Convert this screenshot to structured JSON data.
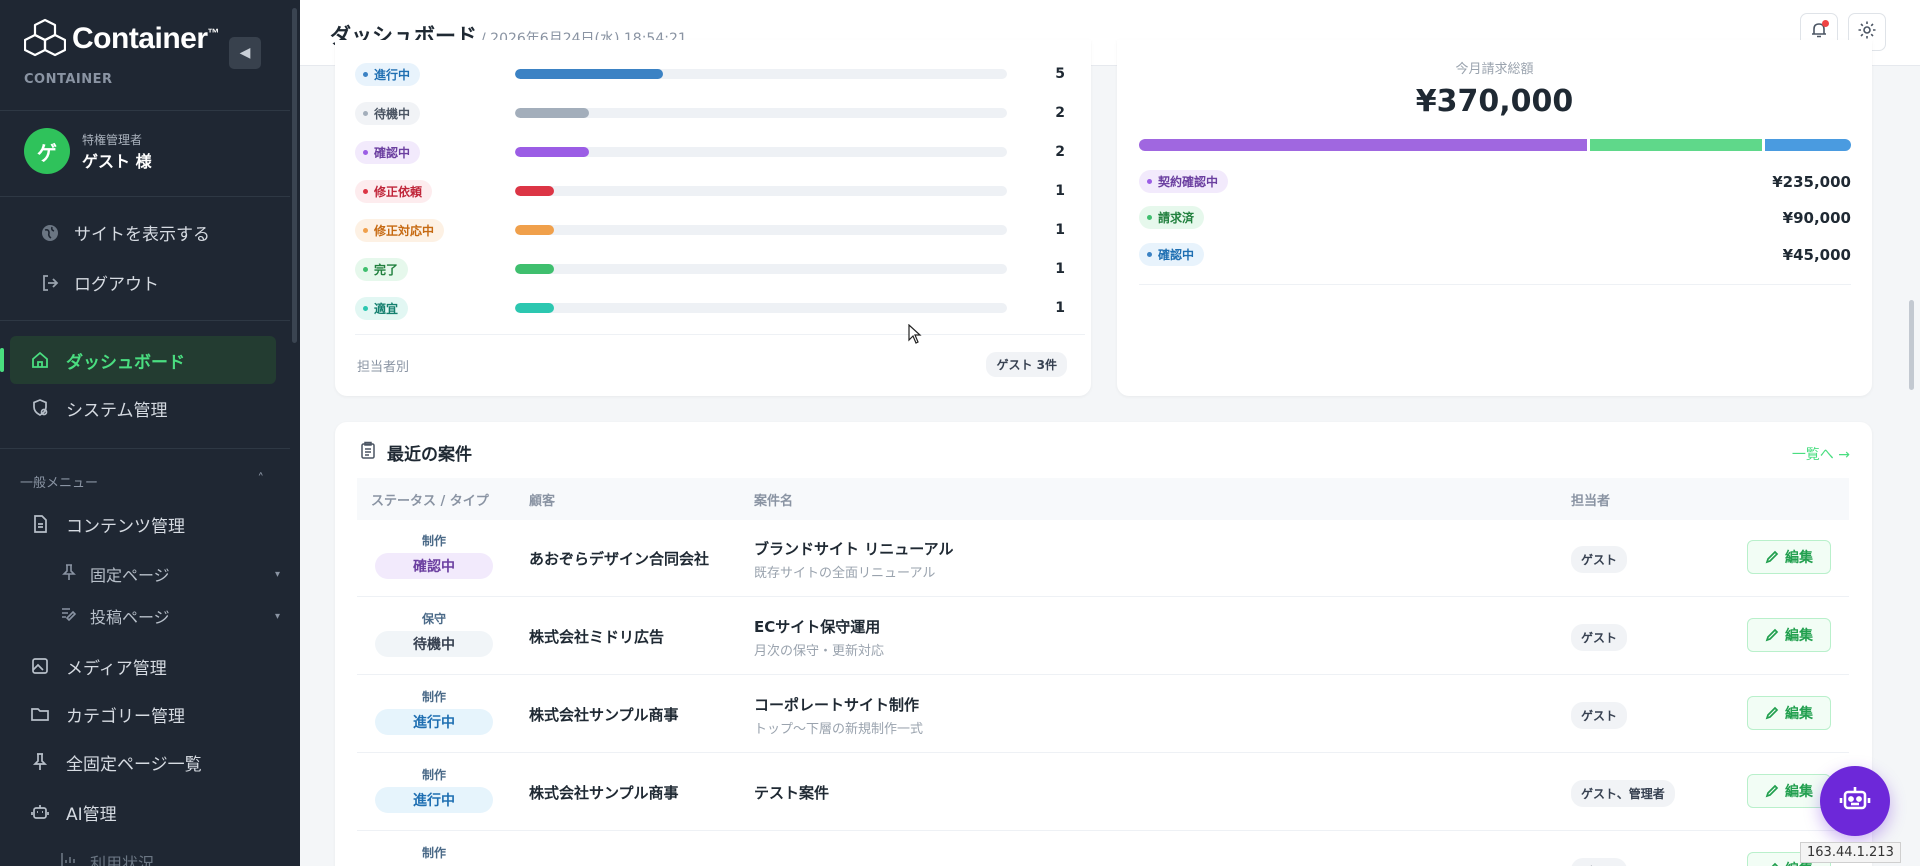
{
  "brand": {
    "name": "Container",
    "tm": "™",
    "subtitle": "CONTAINER"
  },
  "user": {
    "avatar_initial": "ゲ",
    "role": "特権管理者",
    "name": "ゲスト 様"
  },
  "sidebar_links": {
    "view_site": "サイトを表示する",
    "logout": "ログアウト"
  },
  "nav": {
    "dashboard": "ダッシュボード",
    "system": "システム管理",
    "section_label": "一般メニュー",
    "contents": "コンテンツ管理",
    "fixed_pages": "固定ページ",
    "posts": "投稿ページ",
    "media": "メディア管理",
    "category": "カテゴリー管理",
    "all_fixed": "全固定ページ一覧",
    "ai": "AI管理",
    "usage": "利用状況"
  },
  "topbar": {
    "title": "ダッシュボード",
    "date": "/ 2026年6月24日(水) 18:54:21"
  },
  "status_card": {
    "rows": [
      {
        "label": "進行中",
        "count": "5",
        "fraction": 0.3,
        "color": "#3b82c4",
        "bg": "#e8f3fc",
        "text": "#1f6fb2"
      },
      {
        "label": "待機中",
        "count": "2",
        "fraction": 0.15,
        "color": "#a3aebb",
        "bg": "#f1f3f6",
        "text": "#4b5563"
      },
      {
        "label": "確認中",
        "count": "2",
        "fraction": 0.15,
        "color": "#9b5de5",
        "bg": "#f2eafc",
        "text": "#6b3fa0"
      },
      {
        "label": "修正依頼",
        "count": "1",
        "fraction": 0.08,
        "color": "#dc3545",
        "bg": "#fdecee",
        "text": "#c0263a"
      },
      {
        "label": "修正対応中",
        "count": "1",
        "fraction": 0.08,
        "color": "#f0a04b",
        "bg": "#fdf1e4",
        "text": "#c66a12"
      },
      {
        "label": "完了",
        "count": "1",
        "fraction": 0.08,
        "color": "#3fbf6e",
        "bg": "#e6f8ec",
        "text": "#21803e"
      },
      {
        "label": "適宜",
        "count": "1",
        "fraction": 0.08,
        "color": "#2cc7b0",
        "bg": "#e2f7f3",
        "text": "#15806f"
      }
    ],
    "footer_label": "担当者別",
    "footer_chip": "ゲスト 3件"
  },
  "billing_card": {
    "caption": "今月請求総額",
    "total": "¥370,000",
    "segments": [
      {
        "fraction": 0.635,
        "color": "#a067e0"
      },
      {
        "fraction": 0.243,
        "color": "#5fd88a"
      },
      {
        "fraction": 0.122,
        "color": "#4a9be0"
      }
    ],
    "rows": [
      {
        "label": "契約確認中",
        "amount": "¥235,000",
        "bg": "#f2eafc",
        "text": "#6b3fa0",
        "dot": "#9b5de5"
      },
      {
        "label": "請求済",
        "amount": "¥90,000",
        "bg": "#e6f8ec",
        "text": "#21803e",
        "dot": "#3fbf6e"
      },
      {
        "label": "確認中",
        "amount": "¥45,000",
        "bg": "#e8f3fc",
        "text": "#1f6fb2",
        "dot": "#3b82c4"
      }
    ]
  },
  "recent": {
    "title": "最近の案件",
    "link": "一覧へ →",
    "headers": {
      "status": "ステータス / タイプ",
      "client": "顧客",
      "case": "案件名",
      "assignee": "担当者"
    },
    "edit_label": "編集",
    "rows": [
      {
        "type": "制作",
        "status": "確認中",
        "status_bg": "#f2eafc",
        "status_color": "#6b3fa0",
        "client": "あおぞらデザイン合同会社",
        "case": "ブランドサイト リニューアル",
        "sub": "既存サイトの全面リニューアル",
        "assignee": "ゲスト"
      },
      {
        "type": "保守",
        "status": "待機中",
        "status_bg": "#f1f5f8",
        "status_color": "#374151",
        "client": "株式会社ミドリ広告",
        "case": "ECサイト保守運用",
        "sub": "月次の保守・更新対応",
        "assignee": "ゲスト"
      },
      {
        "type": "制作",
        "status": "進行中",
        "status_bg": "#e6f4fc",
        "status_color": "#1f6fb2",
        "client": "株式会社サンプル商事",
        "case": "コーポレートサイト制作",
        "sub": "トップ〜下層の新規制作一式",
        "assignee": "ゲスト"
      },
      {
        "type": "制作",
        "status": "進行中",
        "status_bg": "#e6f4fc",
        "status_color": "#1f6fb2",
        "client": "株式会社サンプル商事",
        "case": "テスト案件",
        "sub": "",
        "assignee": "ゲスト、管理者"
      },
      {
        "type": "制作",
        "status": "",
        "status_bg": "#ffffff",
        "status_color": "#1f6fb2",
        "client": "",
        "case": "",
        "sub": "",
        "assignee": "ゲスト"
      }
    ]
  },
  "ip": "163.44.1.213",
  "colors": {
    "accent": "#4ade80",
    "sidebar_bg": "#1f2733",
    "fab": "#6d28d9"
  }
}
